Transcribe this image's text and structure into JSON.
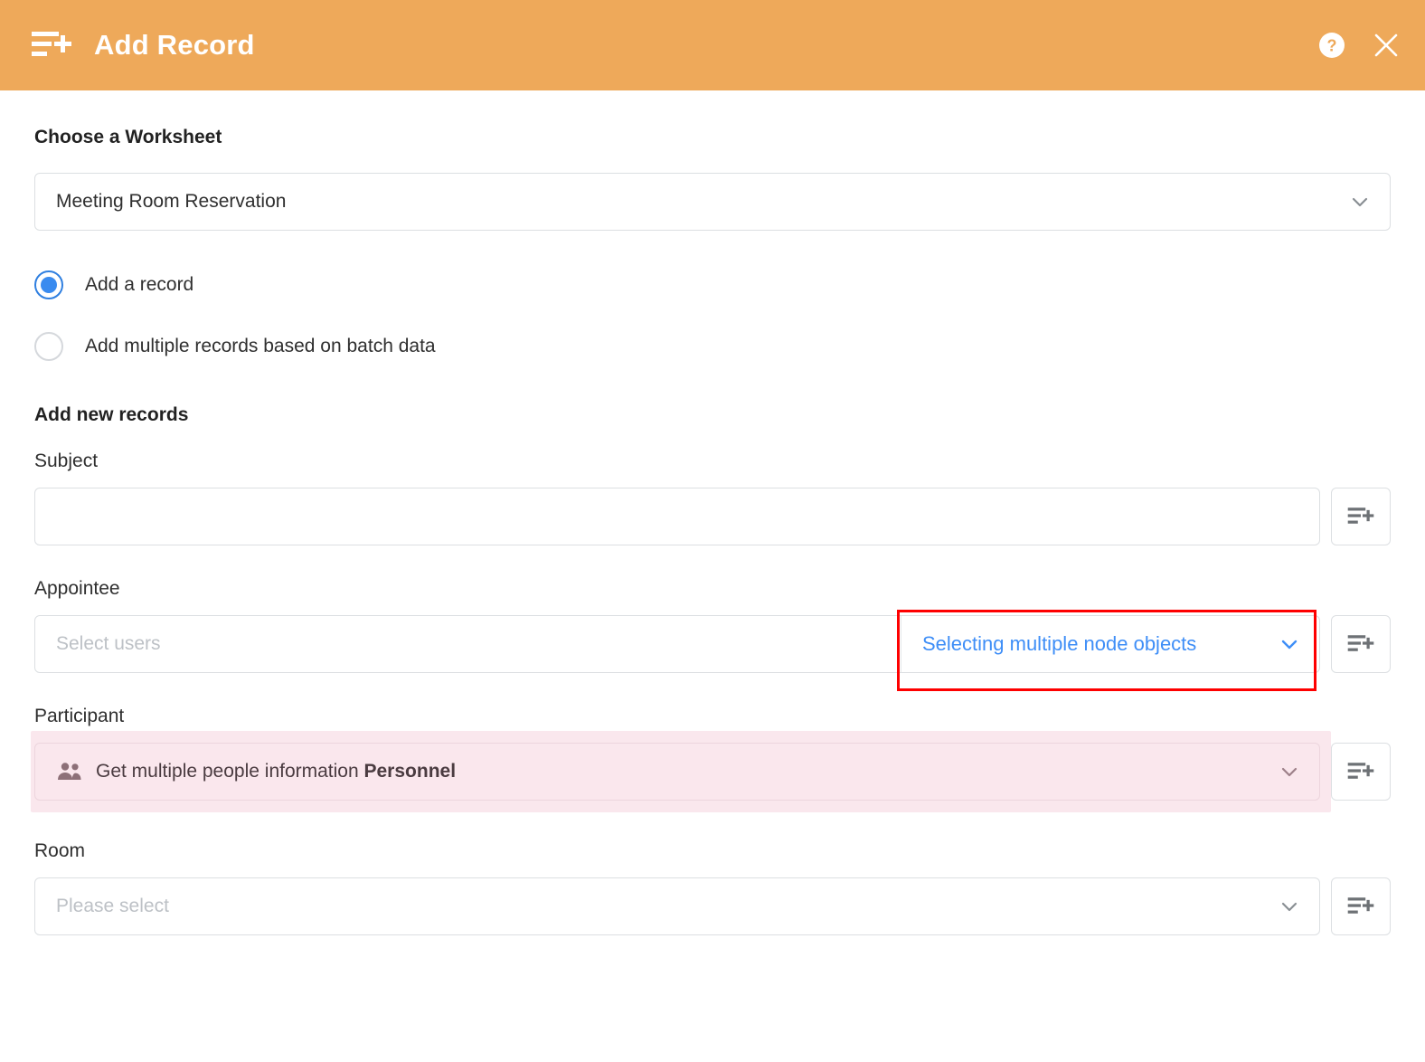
{
  "header": {
    "title": "Add Record",
    "icon": "add-record-icon",
    "help_icon": "help-circle-icon",
    "close_icon": "close-icon",
    "background_color": "#eea95a"
  },
  "worksheet": {
    "heading": "Choose a Worksheet",
    "selected": "Meeting Room Reservation",
    "chevron_icon": "chevron-down-icon"
  },
  "mode_options": [
    {
      "label": "Add a record",
      "selected": true
    },
    {
      "label": "Add multiple records based on batch data",
      "selected": false
    }
  ],
  "records_section": {
    "heading": "Add new records"
  },
  "fields": [
    {
      "label": "Subject",
      "value": "",
      "placeholder": "",
      "trailing_icon": "add-record-icon"
    },
    {
      "label": "Appointee",
      "placeholder": "Select users",
      "dropdown_text": "Selecting multiple node objects",
      "dropdown_color": "#3e8ef7",
      "chevron_icon": "chevron-down-icon",
      "trailing_icon": "add-record-icon",
      "highlight_box_color": "#fe0000"
    },
    {
      "label": "Participant",
      "icon": "people-icon",
      "value_prefix": "Get multiple people information ",
      "value_strong": "Personnel",
      "chevron_icon": "chevron-down-icon",
      "trailing_icon": "add-record-icon",
      "highlight_color": "#fae7ed"
    },
    {
      "label": "Room",
      "placeholder": "Please select",
      "chevron_icon": "chevron-down-icon",
      "trailing_icon": "add-record-icon"
    }
  ]
}
